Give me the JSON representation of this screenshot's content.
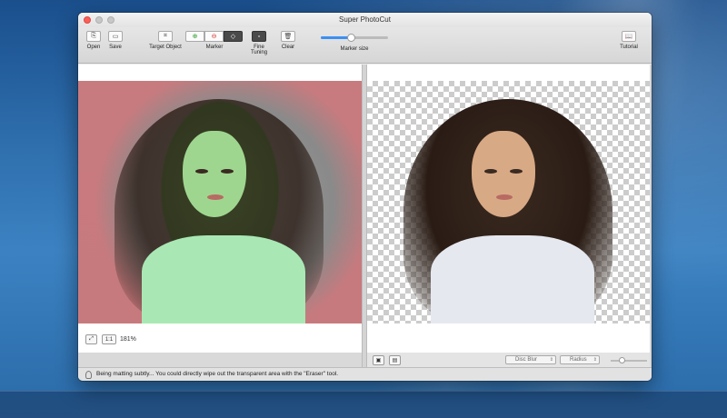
{
  "window": {
    "title": "Super PhotoCut"
  },
  "toolbar": {
    "open_label": "Open",
    "save_label": "Save",
    "target_object_label": "Target Object",
    "marker_label": "Marker",
    "fine_tuning_label": "Fine Tuning",
    "clear_label": "Clear",
    "marker_size_label": "Marker size",
    "marker_size_value": 0.45,
    "tutorial_label": "Tutorial"
  },
  "left_pane": {
    "zoom_value": "181%",
    "actual_size_label": "1:1"
  },
  "right_pane": {
    "blur_select": "Disc Blur",
    "radius_select": "Radius",
    "radius_value": 0.3
  },
  "status": {
    "message": "Being matting subtly... You could directly wipe out the transparent area with the \"Eraser\" tool."
  },
  "colors": {
    "accent": "#3b8ff3",
    "foreground_mark": "#28a028",
    "background_mark": "#c87b7f"
  }
}
